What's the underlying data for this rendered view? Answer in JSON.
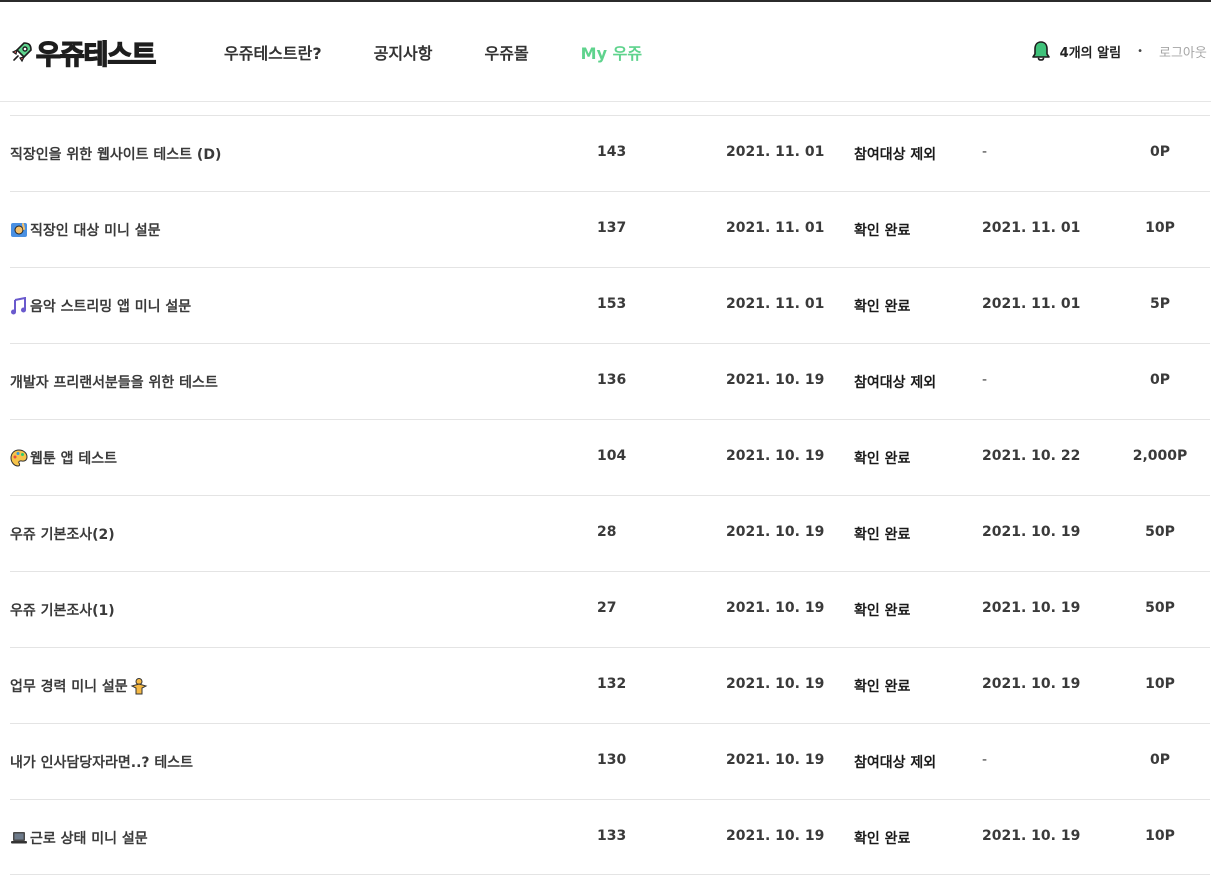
{
  "header": {
    "logo_text": "우쥬테스트",
    "nav": [
      {
        "label": "우쥬테스트란?",
        "active": false
      },
      {
        "label": "공지사항",
        "active": false
      },
      {
        "label": "우쥬몰",
        "active": false
      },
      {
        "label": "My 우쥬",
        "active": true
      }
    ],
    "alarm_label": "4개의 알림",
    "separator": "•",
    "logout_label": "로그아웃"
  },
  "colors": {
    "accent": "#5fd38d",
    "bell": "#3fc27a",
    "text": "#333333",
    "muted": "#a5a5a5",
    "divider": "#e4e4e4"
  },
  "rows": [
    {
      "icon": "",
      "title": "직장인을 위한 웹사이트 테스트 (D)",
      "count": "143",
      "date": "2021. 11. 01",
      "status": "참여대상 제외",
      "confirm": "-",
      "point": "0P"
    },
    {
      "icon": "raising-hand-icon",
      "title": "직장인 대상 미니 설문",
      "count": "137",
      "date": "2021. 11. 01",
      "status": "확인 완료",
      "confirm": "2021. 11. 01",
      "point": "10P"
    },
    {
      "icon": "music-note-icon",
      "title": "음악 스트리밍 앱 미니 설문",
      "count": "153",
      "date": "2021. 11. 01",
      "status": "확인 완료",
      "confirm": "2021. 11. 01",
      "point": "5P"
    },
    {
      "icon": "",
      "title": "개발자 프리랜서분들을 위한 테스트",
      "count": "136",
      "date": "2021. 10. 19",
      "status": "참여대상 제외",
      "confirm": "-",
      "point": "0P"
    },
    {
      "icon": "palette-icon",
      "title": " 웹툰 앱 테스트",
      "count": "104",
      "date": "2021. 10. 19",
      "status": "확인 완료",
      "confirm": "2021. 10. 22",
      "point": "2,000P"
    },
    {
      "icon": "",
      "title": "우쥬 기본조사(2)",
      "count": "28",
      "date": "2021. 10. 19",
      "status": "확인 완료",
      "confirm": "2021. 10. 19",
      "point": "50P"
    },
    {
      "icon": "",
      "title": "우쥬 기본조사(1)",
      "count": "27",
      "date": "2021. 10. 19",
      "status": "확인 완료",
      "confirm": "2021. 10. 19",
      "point": "50P"
    },
    {
      "icon": "",
      "title": "업무 경력 미니 설문",
      "icon_after": "person-icon",
      "count": "132",
      "date": "2021. 10. 19",
      "status": "확인 완료",
      "confirm": "2021. 10. 19",
      "point": "10P"
    },
    {
      "icon": "",
      "title": "내가 인사담당자라면..? 테스트",
      "count": "130",
      "date": "2021. 10. 19",
      "status": "참여대상 제외",
      "confirm": "-",
      "point": "0P"
    },
    {
      "icon": "laptop-icon",
      "title": "근로 상태 미니 설문",
      "count": "133",
      "date": "2021. 10. 19",
      "status": "확인 완료",
      "confirm": "2021. 10. 19",
      "point": "10P"
    }
  ]
}
